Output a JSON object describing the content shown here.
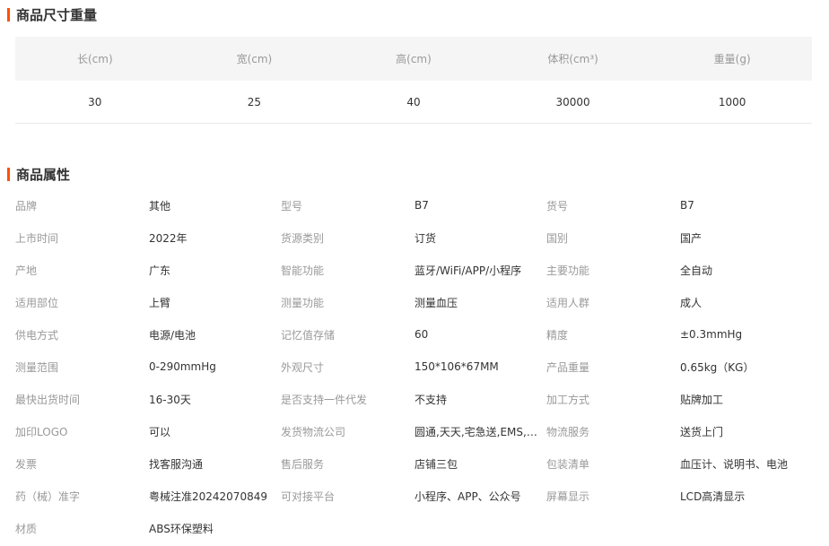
{
  "dimensions": {
    "title": "商品尺寸重量",
    "headers": [
      "长(cm)",
      "宽(cm)",
      "高(cm)",
      "体积(cm³)",
      "重量(g)"
    ],
    "values": [
      "30",
      "25",
      "40",
      "30000",
      "1000"
    ]
  },
  "attributes": {
    "title": "商品属性",
    "rows": [
      [
        [
          "品牌",
          "其他"
        ],
        [
          "型号",
          "B7"
        ],
        [
          "货号",
          "B7"
        ]
      ],
      [
        [
          "上市时间",
          "2022年"
        ],
        [
          "货源类别",
          "订货"
        ],
        [
          "国别",
          "国产"
        ]
      ],
      [
        [
          "产地",
          "广东"
        ],
        [
          "智能功能",
          "蓝牙/WiFi/APP/小程序"
        ],
        [
          "主要功能",
          "全自动"
        ]
      ],
      [
        [
          "适用部位",
          "上臂"
        ],
        [
          "测量功能",
          "测量血压"
        ],
        [
          "适用人群",
          "成人"
        ]
      ],
      [
        [
          "供电方式",
          "电源/电池"
        ],
        [
          "记忆值存储",
          "60"
        ],
        [
          "精度",
          "±0.3mmHg"
        ]
      ],
      [
        [
          "测量范围",
          "0-290mmHg"
        ],
        [
          "外观尺寸",
          "150*106*67MM"
        ],
        [
          "产品重量",
          "0.65kg（KG）"
        ]
      ],
      [
        [
          "最快出货时间",
          "16-30天"
        ],
        [
          "是否支持一件代发",
          "不支持"
        ],
        [
          "加工方式",
          "贴牌加工"
        ]
      ],
      [
        [
          "加印LOGO",
          "可以"
        ],
        [
          "发货物流公司",
          "圆通,天天,宅急送,EMS,顺丰"
        ],
        [
          "物流服务",
          "送货上门"
        ]
      ],
      [
        [
          "发票",
          "找客服沟通"
        ],
        [
          "售后服务",
          "店铺三包"
        ],
        [
          "包装清单",
          "血压计、说明书、电池"
        ]
      ],
      [
        [
          "药（械）准字",
          "粤械注准20242070849"
        ],
        [
          "可对接平台",
          "小程序、APP、公众号"
        ],
        [
          "屏幕显示",
          "LCD高清显示"
        ]
      ],
      [
        [
          "材质",
          "ABS环保塑料"
        ]
      ]
    ]
  }
}
